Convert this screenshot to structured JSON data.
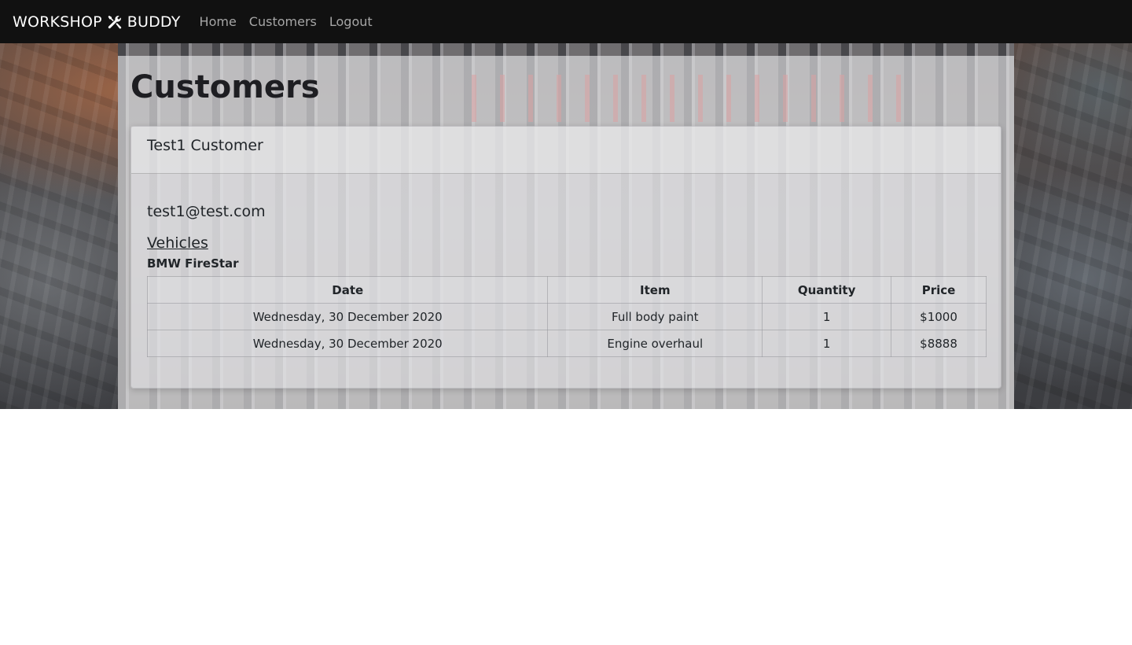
{
  "navbar": {
    "brand_left": "WORKSHOP",
    "brand_icon": "tools-icon",
    "brand_right": "BUDDY",
    "links": [
      {
        "label": "Home"
      },
      {
        "label": "Customers"
      },
      {
        "label": "Logout"
      }
    ]
  },
  "page": {
    "title": "Customers"
  },
  "customer": {
    "name": "Test1 Customer",
    "email": "test1@test.com",
    "vehicles_heading": "Vehicles",
    "vehicles": [
      {
        "name": "BMW FireStar",
        "columns": [
          "Date",
          "Item",
          "Quantity",
          "Price"
        ],
        "rows": [
          {
            "date": "Wednesday, 30 December 2020",
            "item": "Full body paint",
            "quantity": "1",
            "price": "$1000"
          },
          {
            "date": "Wednesday, 30 December 2020",
            "item": "Engine overhaul",
            "quantity": "1",
            "price": "$8888"
          }
        ]
      }
    ]
  },
  "colors": {
    "navbar_bg": "#111111",
    "nav_link": "#a6a6a6",
    "brand_text": "#ffffff",
    "text": "#212529"
  }
}
